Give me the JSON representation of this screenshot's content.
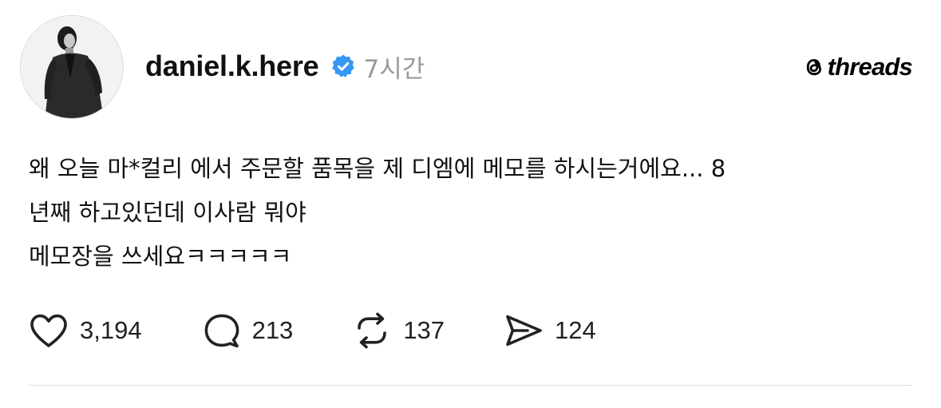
{
  "post": {
    "username": "daniel.k.here",
    "verified": true,
    "timestamp": "7시간",
    "brand": "threads",
    "body_line1": "왜 오늘 마*컬리 에서 주문할 품목을 제 디엠에 메모를 하시는거에요... 8",
    "body_line2": "년째 하고있던데 이사람 뭐야",
    "body_line3": "메모장을 쓰세요ㅋㅋㅋㅋㅋ"
  },
  "actions": {
    "like_count": "3,194",
    "reply_count": "213",
    "repost_count": "137",
    "share_count": "124"
  },
  "icons": {
    "verified": "verified-badge-icon",
    "brand": "threads-logo-icon",
    "like": "heart-icon",
    "reply": "speech-bubble-icon",
    "repost": "repost-arrows-icon",
    "share": "paper-plane-icon"
  },
  "colors": {
    "verified_blue": "#3897f0",
    "timestamp_gray": "#9a9a9a",
    "text": "#111111"
  }
}
